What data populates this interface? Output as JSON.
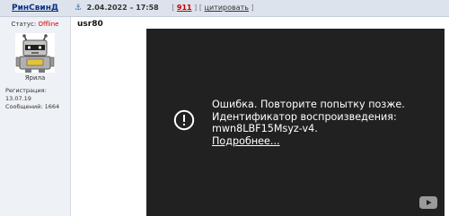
{
  "post_header": {
    "author": "РинСвинД",
    "anchor_icon": "anchor-icon",
    "date": "2.04.2022 – 17:58",
    "post_number": "911",
    "quote_label": "цитировать",
    "bracket_open": "[",
    "bracket_close": "]"
  },
  "user_panel": {
    "status_label": "Статус:",
    "status_value": "Offline",
    "avatar_icon": "robot-avatar-icon",
    "rank": "Ярила",
    "reg_label": "Регистрация: 13.07.19",
    "msgs_label": "Сообщений: 1664"
  },
  "post": {
    "title": "usr80"
  },
  "video": {
    "error_icon": "error-circle-icon",
    "error_line1": "Ошибка. Повторите попытку позже.",
    "error_line2": "Идентификатор воспроизведения:",
    "error_line3": "mwn8LBF15Msyz-v4.",
    "more_link": "Подробнее...",
    "logo_icon": "youtube-logo-icon"
  },
  "colors": {
    "header_bg": "#dde3ec",
    "panel_bg": "#eef1f6",
    "author_link": "#0b2e87",
    "offline_red": "#d00000",
    "video_bg": "#212121"
  }
}
